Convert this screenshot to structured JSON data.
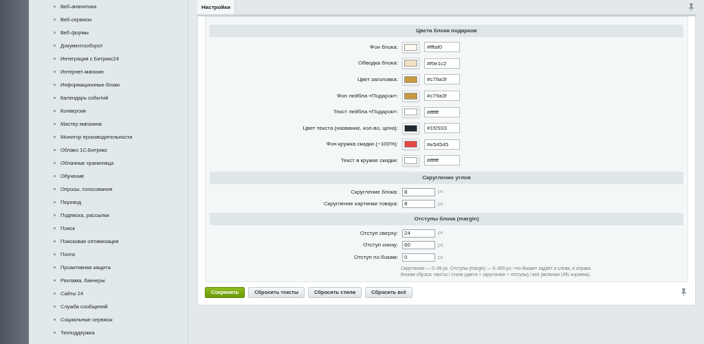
{
  "sidebar": {
    "items": [
      "Веб-аналитика",
      "Веб-сервисы",
      "Веб-формы",
      "Документооборот",
      "Интеграция с Битрикс24",
      "Интернет-магазин",
      "Информационные блоки",
      "Календарь событий",
      "Конверсия",
      "Мастер магазина",
      "Монитор производительности",
      "Облако 1С-Битрикс",
      "Облачные хранилища",
      "Обучение",
      "Опросы, голосования",
      "Перевод",
      "Подписка, рассылки",
      "Поиск",
      "Поисковая оптимизация",
      "Почта",
      "Проактивная защита",
      "Реклама, баннеры",
      "Сайты 24",
      "Служба сообщений",
      "Социальные сервисы",
      "Техподдержка"
    ]
  },
  "tabs": [
    {
      "label": "Настройки",
      "selected": true
    }
  ],
  "sections": [
    {
      "title": "Цвета блока подарков",
      "kind": "colors",
      "rows": [
        {
          "label": "Фон блока:",
          "value": "#fffaf0",
          "color": "#fffaf0"
        },
        {
          "label": "Обводка блока:",
          "value": "#f0e1c2",
          "color": "#f0e1c2"
        },
        {
          "label": "Цвет заголовка:",
          "value": "#c79a3f",
          "color": "#c79a3f"
        },
        {
          "label": "Фон лейбла «Подарок»:",
          "value": "#c79a3f",
          "color": "#c79a3f"
        },
        {
          "label": "Текст лейбла «Подарок»:",
          "value": "#ffffff",
          "color": "#ffffff"
        },
        {
          "label": "Цвет текста (название, кол-во, цена):",
          "value": "#1f2933",
          "color": "#1f2933"
        },
        {
          "label": "Фон кружка скидки (−100%):",
          "value": "#e54545",
          "color": "#e54545"
        },
        {
          "label": "Текст в кружке скидки:",
          "value": "#ffffff",
          "color": "#ffffff"
        }
      ]
    },
    {
      "title": "Скругление углов",
      "kind": "numbers",
      "rows": [
        {
          "label": "Скругление блока:",
          "value": "8",
          "unit": "px"
        },
        {
          "label": "Скругление картинки товара:",
          "value": "8",
          "unit": "px"
        }
      ]
    },
    {
      "title": "Отступы блока (margin)",
      "kind": "numbers",
      "rows": [
        {
          "label": "Отступ сверху:",
          "value": "24",
          "unit": "px"
        },
        {
          "label": "Отступ снизу:",
          "value": "60",
          "unit": "px"
        },
        {
          "label": "Отступ по бокам:",
          "value": "0",
          "unit": "px"
        }
      ]
    }
  ],
  "notes": [
    "Скругление — 0–99 px. Отступы (margin) — 0–999 px; «по бокам» задаёт и слева, и справа.",
    "Кнопки сброса: тексты / стили (цвета + скругление + отступы) / всё (включая URL корзины)."
  ],
  "buttons": [
    {
      "label": "Сохранить",
      "kind": "primary"
    },
    {
      "label": "Сбросить тексты",
      "kind": "default"
    },
    {
      "label": "Сбросить стили",
      "kind": "default"
    },
    {
      "label": "Сбросить всё",
      "kind": "default"
    }
  ]
}
